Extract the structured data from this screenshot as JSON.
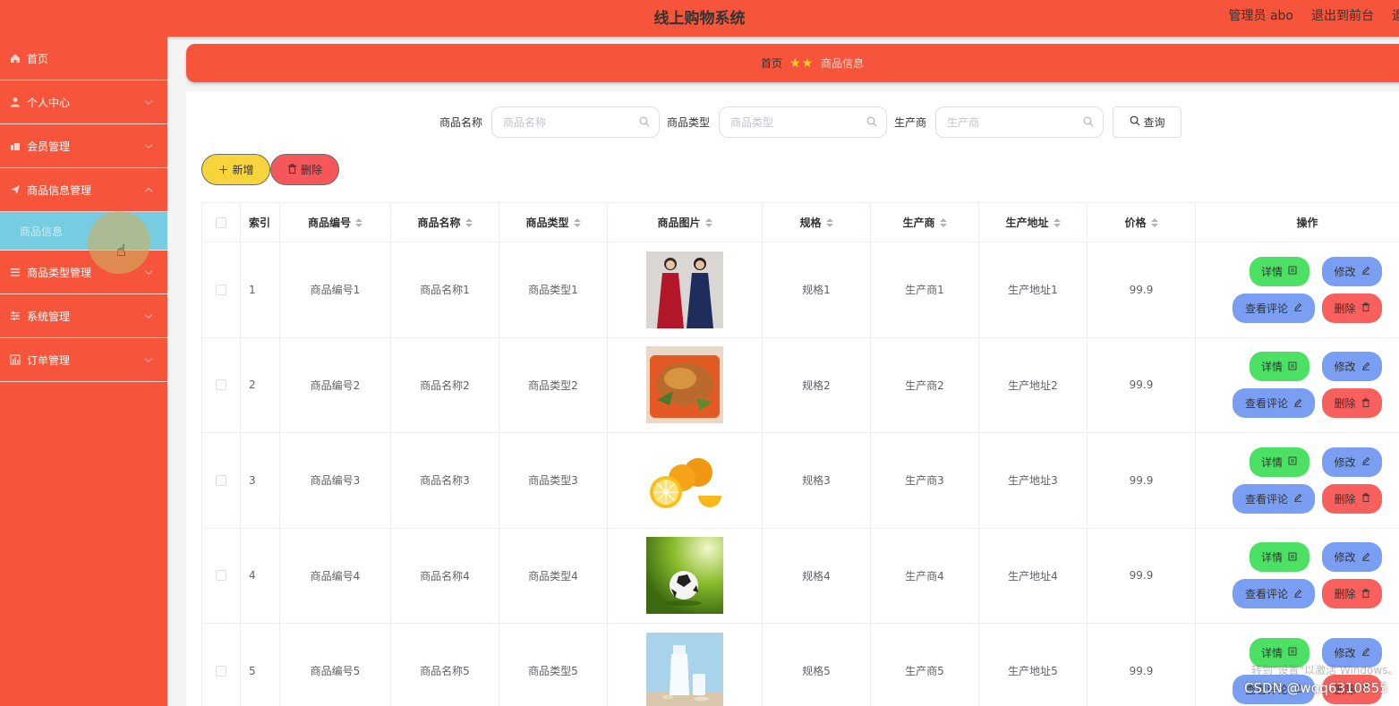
{
  "header": {
    "title": "线上购物系统",
    "admin_label": "管理员 abo",
    "exit_label": "退出到前台",
    "overflow_label": "退"
  },
  "sidebar": {
    "items": [
      {
        "label": "首页",
        "icon": "home-icon"
      },
      {
        "label": "个人中心",
        "icon": "user-icon"
      },
      {
        "label": "会员管理",
        "icon": "members-icon"
      },
      {
        "label": "商品信息管理",
        "icon": "send-icon"
      },
      {
        "label": "商品信息",
        "icon": ""
      },
      {
        "label": "商品类型管理",
        "icon": "list-icon"
      },
      {
        "label": "系统管理",
        "icon": "settings-icon"
      },
      {
        "label": "订单管理",
        "icon": "chart-icon"
      }
    ]
  },
  "breadcrumb": {
    "home": "首页",
    "current": "商品信息"
  },
  "search": {
    "name_label": "商品名称",
    "name_placeholder": "商品名称",
    "type_label": "商品类型",
    "type_placeholder": "商品类型",
    "maker_label": "生产商",
    "maker_placeholder": "生产商",
    "query_label": "查询"
  },
  "toolbar": {
    "add_label": "新增",
    "delete_label": "删除"
  },
  "table": {
    "headers": [
      "索引",
      "商品编号",
      "商品名称",
      "商品类型",
      "商品图片",
      "规格",
      "生产商",
      "生产地址",
      "价格",
      "操作"
    ],
    "rows": [
      {
        "index": "1",
        "code": "商品编号1",
        "name": "商品名称1",
        "type": "商品类型1",
        "image": "dresses",
        "spec": "规格1",
        "maker": "生产商1",
        "address": "生产地址1",
        "price": "99.9"
      },
      {
        "index": "2",
        "code": "商品编号2",
        "name": "商品名称2",
        "type": "商品类型2",
        "image": "roast-chicken",
        "spec": "规格2",
        "maker": "生产商2",
        "address": "生产地址2",
        "price": "99.9"
      },
      {
        "index": "3",
        "code": "商品编号3",
        "name": "商品名称3",
        "type": "商品类型3",
        "image": "oranges",
        "spec": "规格3",
        "maker": "生产商3",
        "address": "生产地址3",
        "price": "99.9"
      },
      {
        "index": "4",
        "code": "商品编号4",
        "name": "商品名称4",
        "type": "商品类型4",
        "image": "football",
        "spec": "规格4",
        "maker": "生产商4",
        "address": "生产地址4",
        "price": "99.9"
      },
      {
        "index": "5",
        "code": "商品编号5",
        "name": "商品名称5",
        "type": "商品类型5",
        "image": "milk",
        "spec": "规格5",
        "maker": "生产商5",
        "address": "生产地址5",
        "price": "99.9"
      }
    ],
    "actions": {
      "detail": "详情",
      "edit": "修改",
      "review": "查看评论",
      "remove": "删除"
    }
  },
  "overlay": {
    "windows_watermark": "转到\"设置\"以激活 Windows。",
    "csdn": "CSDN @wqq6310855"
  },
  "colors": {
    "brand": "#f6553b",
    "submenu": "#76cde2",
    "add": "#f7d33c",
    "delete": "#f5575a",
    "detail": "#4ce164",
    "edit": "#7a9ef2"
  }
}
